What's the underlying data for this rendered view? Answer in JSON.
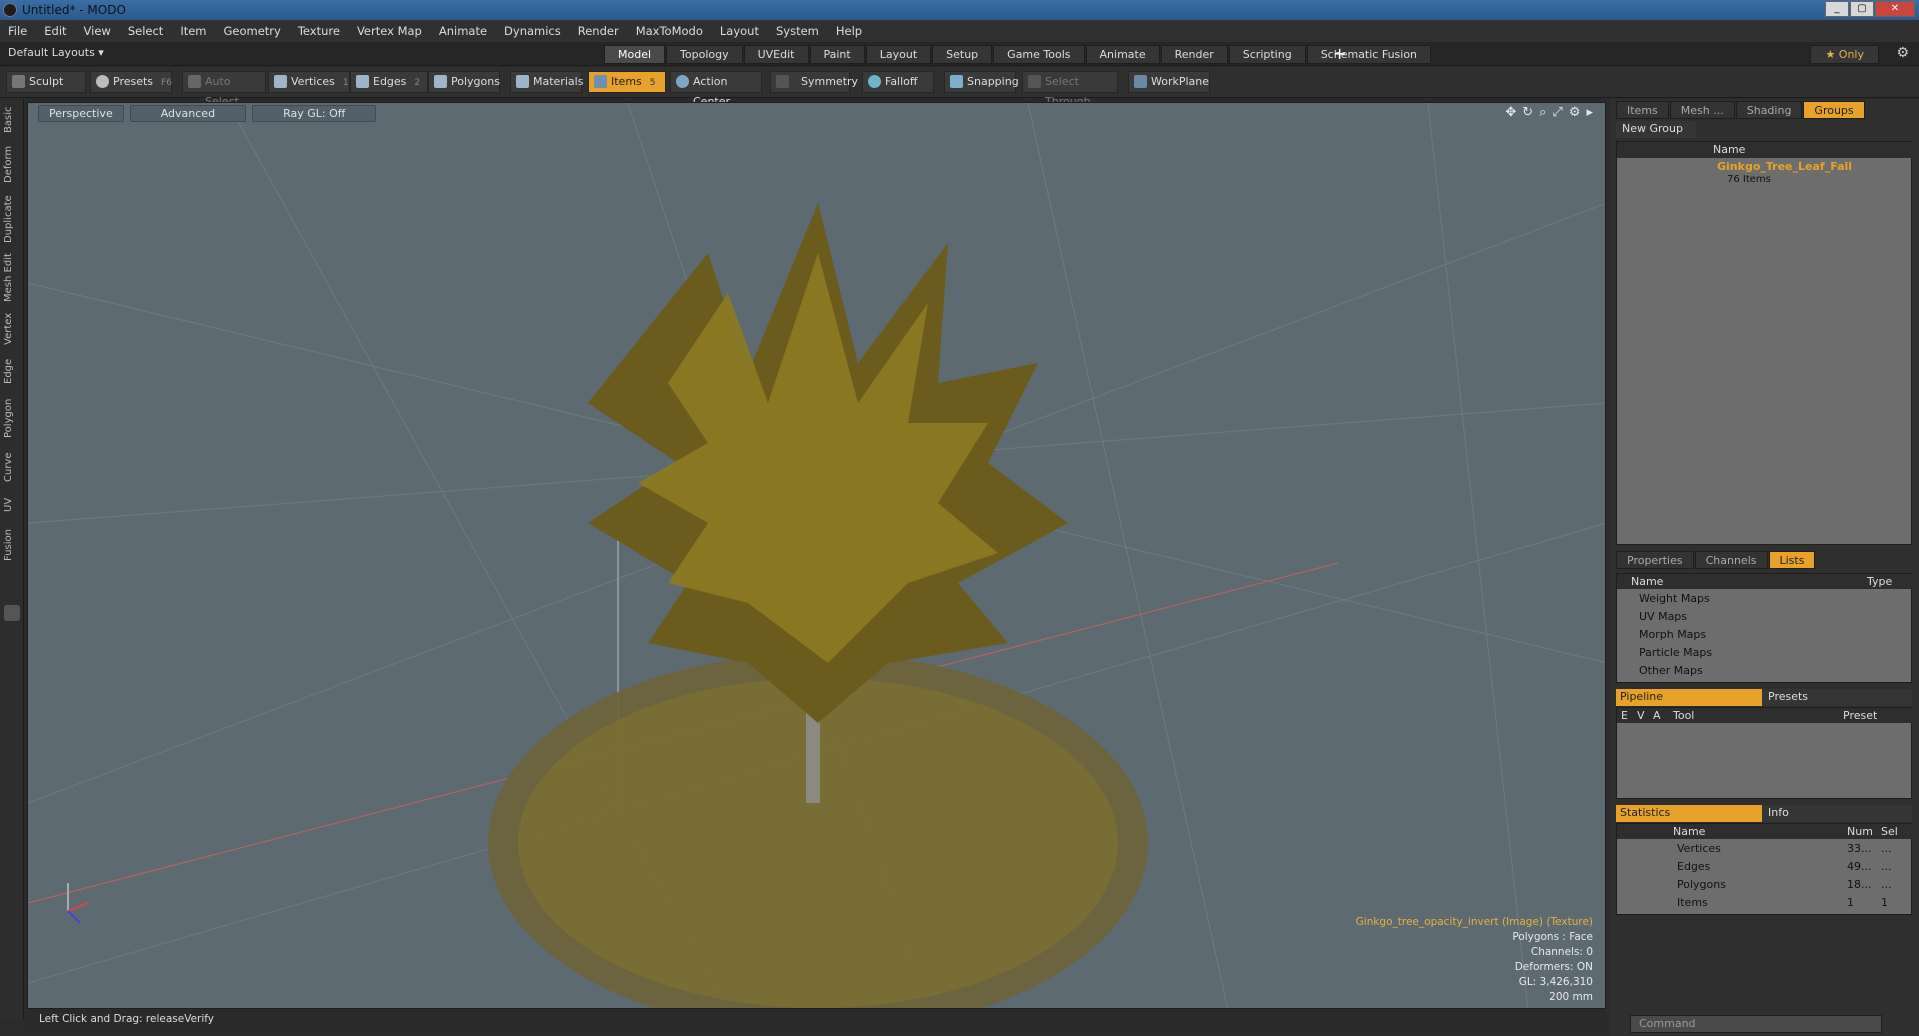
{
  "window": {
    "title": "Untitled* - MODO",
    "min": "_",
    "max": "▢",
    "close": "✕"
  },
  "menu": [
    "File",
    "Edit",
    "View",
    "Select",
    "Item",
    "Geometry",
    "Texture",
    "Vertex Map",
    "Animate",
    "Dynamics",
    "Render",
    "MaxToModo",
    "Layout",
    "System",
    "Help"
  ],
  "layout": {
    "selector": "Default Layouts ▾",
    "tabs": [
      "Model",
      "Topology",
      "UVEdit",
      "Paint",
      "Layout",
      "Setup",
      "Game Tools",
      "Animate",
      "Render",
      "Scripting",
      "Schematic Fusion"
    ],
    "active_tab": "Model",
    "only": "★  Only"
  },
  "toolbar": {
    "sculpt": "Sculpt",
    "presets": "Presets",
    "presets_key": "F6",
    "auto_select": "Auto Select",
    "vertices": "Vertices",
    "vertices_num": "1",
    "edges": "Edges",
    "edges_num": "2",
    "polygons": "Polygons",
    "materials": "Materials",
    "items": "Items",
    "items_num": "5",
    "action_center": "Action Center",
    "symmetry": "Symmetry",
    "falloff": "Falloff",
    "snapping": "Snapping",
    "select_through": "Select Through",
    "workplane": "WorkPlane"
  },
  "left_tabs": [
    "Basic",
    "Deform",
    "Duplicate",
    "Mesh Edit",
    "Vertex",
    "Edge",
    "Polygon",
    "Curve",
    "UV",
    "Fusion"
  ],
  "viewport": {
    "perspective": "Perspective",
    "advanced": "Advanced",
    "raygl": "Ray GL: Off",
    "info": {
      "texture": "Ginkgo_tree_opacity_invert (Image) (Texture)",
      "polygons": "Polygons : Face",
      "channels": "Channels: 0",
      "deformers": "Deformers: ON",
      "gl": "GL: 3,426,310",
      "scale": "200 mm"
    }
  },
  "status": {
    "text": "Left Click and Drag:  releaseVerify"
  },
  "right": {
    "top_tabs": [
      "Items",
      "Mesh ...",
      "Shading",
      "Groups"
    ],
    "active_top": "Groups",
    "new_group": "New Group",
    "name_col": "Name",
    "group_name": "Ginkgo_Tree_Leaf_Fall",
    "group_count": "76 Items",
    "mid_tabs": [
      "Properties",
      "Channels",
      "Lists"
    ],
    "active_mid": "Lists",
    "lists_cols": {
      "name": "Name",
      "type": "Type"
    },
    "lists": [
      "Weight Maps",
      "UV Maps",
      "Morph Maps",
      "Particle Maps",
      "Other Maps"
    ],
    "pipeline": "Pipeline",
    "presets": "Presets",
    "pipe_cols": {
      "e": "E",
      "v": "V",
      "a": "A",
      "tool": "Tool",
      "preset": "Preset"
    },
    "statistics": "Statistics",
    "info_tab": "Info",
    "stats_cols": {
      "name": "Name",
      "num": "Num",
      "sel": "Sel"
    },
    "stats": [
      {
        "name": "Vertices",
        "num": "33...",
        "sel": "..."
      },
      {
        "name": "Edges",
        "num": "49...",
        "sel": "..."
      },
      {
        "name": "Polygons",
        "num": "18...",
        "sel": "..."
      },
      {
        "name": "Items",
        "num": "1",
        "sel": "1"
      }
    ],
    "command_placeholder": "Command"
  }
}
